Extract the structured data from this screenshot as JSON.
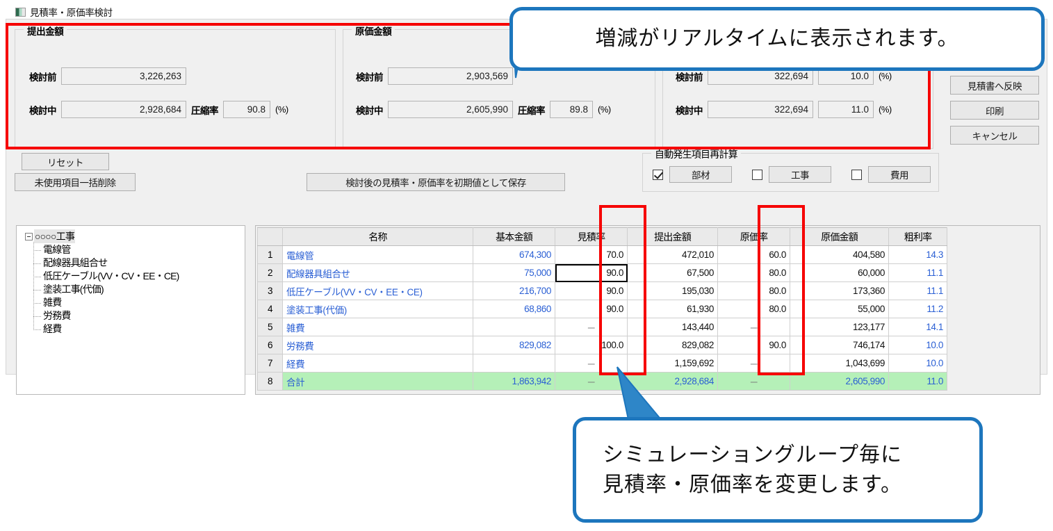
{
  "window": {
    "title": "見積率・原価率検討",
    "icon": "app-icon"
  },
  "panels": {
    "submit_amount": {
      "legend": "提出金額",
      "before_label": "検討前",
      "before_value": "3,226,263",
      "during_label": "検討中",
      "during_value": "2,928,684",
      "ratio_label": "圧縮率",
      "ratio_value": "90.8",
      "pct": "(%)"
    },
    "cost_amount": {
      "legend": "原価金額",
      "before_label": "検討前",
      "before_value": "2,903,569",
      "during_label": "検討中",
      "during_value": "2,605,990",
      "ratio_label": "圧縮率",
      "ratio_value": "89.8",
      "pct": "(%)"
    },
    "profit": {
      "before_label": "検討前",
      "before_value": "322,694",
      "before_rate": "10.0",
      "during_label": "検討中",
      "during_value": "322,694",
      "during_rate": "11.0",
      "pct": "(%)"
    },
    "recalc": {
      "legend": "自動発生項目再計算",
      "items": [
        {
          "label": "部材",
          "checked": true
        },
        {
          "label": "工事",
          "checked": false
        },
        {
          "label": "費用",
          "checked": false
        }
      ]
    }
  },
  "buttons": {
    "reflect": "見積書へ反映",
    "print": "印刷",
    "cancel": "キャンセル",
    "reset": "リセット",
    "delete_unused": "未使用項目一括削除",
    "save_initial": "検討後の見積率・原価率を初期値として保存"
  },
  "tree": {
    "root": "○○○○工事",
    "nodes": [
      "電線管",
      "配線器具組合せ",
      "低圧ケーブル(VV・CV・EE・CE)",
      "塗装工事(代価)",
      "雑費",
      "労務費",
      "経費"
    ]
  },
  "grid": {
    "columns": [
      "",
      "名称",
      "基本金額",
      "見積率",
      "提出金額",
      "原価率",
      "原価金額",
      "粗利率"
    ],
    "selected_cell": {
      "row": 2,
      "column": "見積率"
    },
    "rows": [
      {
        "no": "1",
        "name": "電線管",
        "base": "674,300",
        "est_rate": "70.0",
        "submit": "472,010",
        "cost_rate": "60.0",
        "cost": "404,580",
        "profit_rate": "14.3"
      },
      {
        "no": "2",
        "name": "配線器具組合せ",
        "base": "75,000",
        "est_rate": "90.0",
        "submit": "67,500",
        "cost_rate": "80.0",
        "cost": "60,000",
        "profit_rate": "11.1"
      },
      {
        "no": "3",
        "name": "低圧ケーブル(VV・CV・EE・CE)",
        "base": "216,700",
        "est_rate": "90.0",
        "submit": "195,030",
        "cost_rate": "80.0",
        "cost": "173,360",
        "profit_rate": "11.1"
      },
      {
        "no": "4",
        "name": "塗装工事(代価)",
        "base": "68,860",
        "est_rate": "90.0",
        "submit": "61,930",
        "cost_rate": "80.0",
        "cost": "55,000",
        "profit_rate": "11.2"
      },
      {
        "no": "5",
        "name": "雑費",
        "base": "",
        "est_rate": "－",
        "submit": "143,440",
        "cost_rate": "－",
        "cost": "123,177",
        "profit_rate": "14.1"
      },
      {
        "no": "6",
        "name": "労務費",
        "base": "829,082",
        "est_rate": "100.0",
        "submit": "829,082",
        "cost_rate": "90.0",
        "cost": "746,174",
        "profit_rate": "10.0"
      },
      {
        "no": "7",
        "name": "経費",
        "base": "",
        "est_rate": "－",
        "submit": "1,159,692",
        "cost_rate": "－",
        "cost": "1,043,699",
        "profit_rate": "10.0"
      },
      {
        "no": "8",
        "name": "合計",
        "base": "1,863,942",
        "est_rate": "－",
        "submit": "2,928,684",
        "cost_rate": "－",
        "cost": "2,605,990",
        "profit_rate": "11.0"
      }
    ]
  },
  "annotations": {
    "callout_top": "増減がリアルタイムに表示されます。",
    "callout_bottom_line1": "シミュレーショングループ毎に",
    "callout_bottom_line2": "見積率・原価率を変更します。",
    "highlight_color": "#f60000",
    "callout_border_color": "#1d76bd"
  }
}
